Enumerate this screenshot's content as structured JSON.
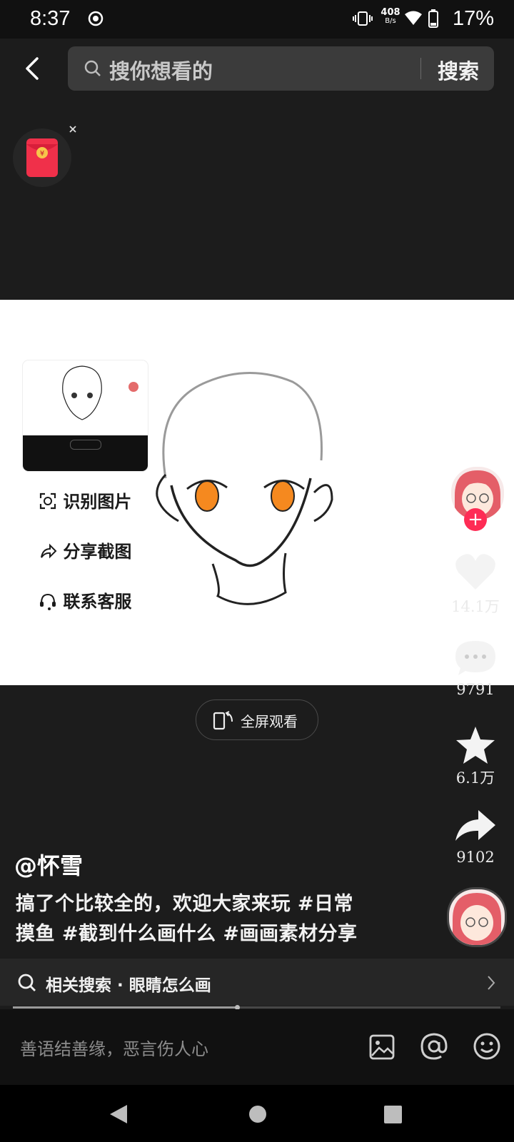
{
  "status_bar": {
    "time": "8:37",
    "net_speed": "408",
    "net_unit": "B/s",
    "battery": "17%"
  },
  "header": {
    "search_placeholder": "搜你想看的",
    "search_button": "搜索"
  },
  "video_menu": {
    "identify": "识别图片",
    "share": "分享截图",
    "support": "联系客服"
  },
  "fullscreen_label": "全屏观看",
  "actions": {
    "likes": "14.1万",
    "comments": "9791",
    "favorites": "6.1万",
    "shares": "9102"
  },
  "post": {
    "author": "@怀雪",
    "desc_line1": "搞了个比较全的，欢迎大家来玩 #日常",
    "desc_line2": "摸鱼 #截到什么画什么 #画画素材分享"
  },
  "related": {
    "text": "相关搜索 · 眼睛怎么画"
  },
  "progress": 0.46,
  "comment": {
    "placeholder": "善语结善缘，恶言伤人心"
  },
  "colors": {
    "accent_red": "#fe2c55",
    "eye_orange": "#f5891f"
  }
}
